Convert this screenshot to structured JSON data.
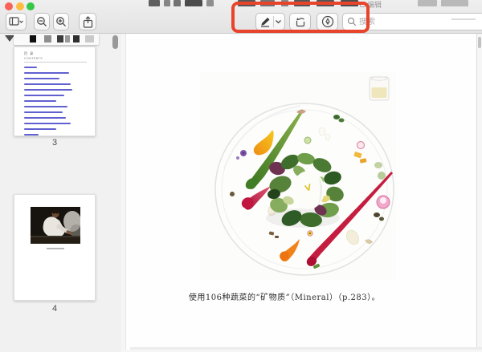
{
  "window": {
    "edit_button": "编辑"
  },
  "toolbar": {
    "search_placeholder": "搜索",
    "buttons": {
      "sidebar_view": "sidebar-view",
      "zoom_out": "zoom-out",
      "zoom_in": "zoom-in",
      "share": "share",
      "markup_pen": "markup-pen",
      "rotate": "rotate-left",
      "draw": "markup-draw"
    }
  },
  "annotation_box": {
    "color": "#e8432b"
  },
  "sidebar": {
    "page3_thumb": {
      "toc_title": "目 录",
      "toc_subtitle": "CONTENTS",
      "link_widths": [
        16,
        56,
        44,
        58,
        60,
        50,
        40,
        54,
        48,
        52,
        58,
        40,
        18
      ],
      "page_number": "3"
    },
    "page4_thumb": {
      "page_number": "4"
    }
  },
  "main": {
    "caption": "使用106种蔬菜的“矿物质”（Mineral）（p.283）。"
  }
}
